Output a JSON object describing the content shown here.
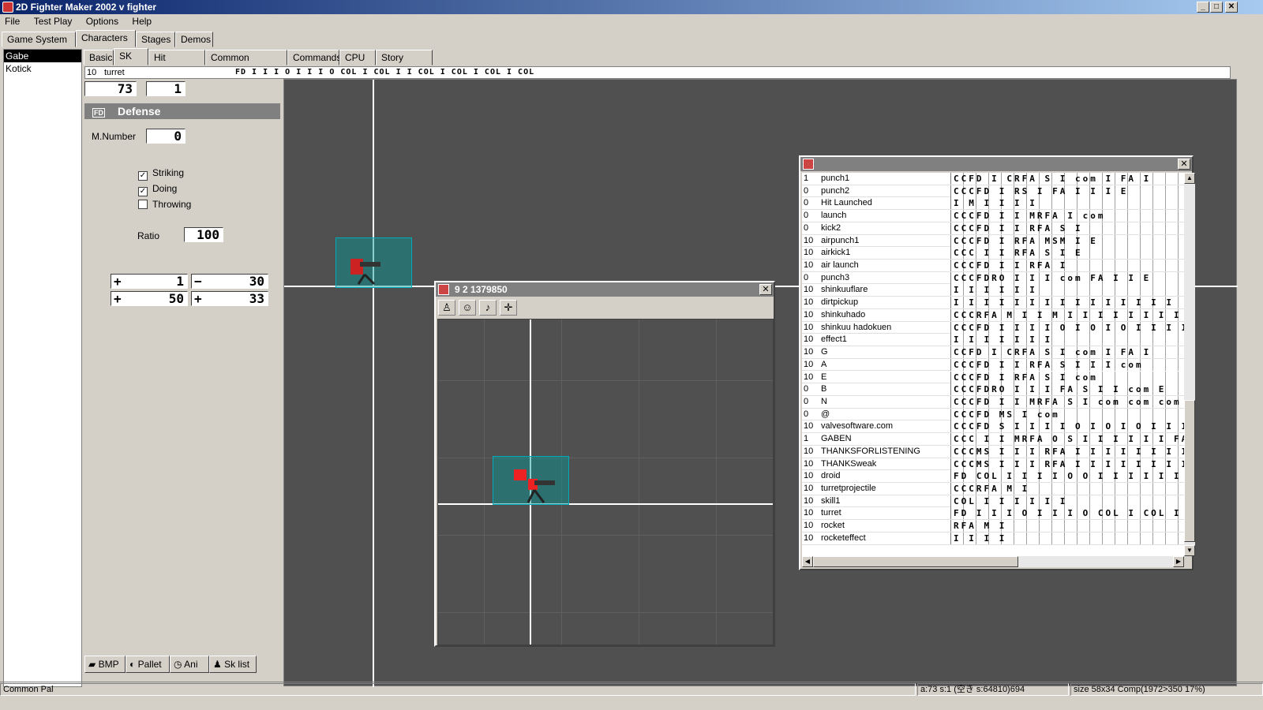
{
  "window": {
    "title": "2D Fighter Maker 2002  v fighter"
  },
  "menu": [
    "File",
    "Test Play",
    "Options",
    "Help"
  ],
  "main_tabs": [
    "Game System",
    "Characters",
    "Stages",
    "Demos"
  ],
  "characters": [
    "Gabe",
    "Kotick"
  ],
  "sub_tabs": [
    "Basic",
    "SK",
    "Hit Junction",
    "Common Images",
    "Commands",
    "CPU",
    "Story mode"
  ],
  "sk_field": {
    "num": "10",
    "name": "turret",
    "cmds": "FD I I I O I I I O COL I COL I I COL I COL I COL I COL"
  },
  "fields": {
    "frame": "73",
    "sub": "1"
  },
  "defense": {
    "fd": "FD",
    "title": "Defense",
    "mnumber_label": "M.Number",
    "mnumber": "0",
    "striking": "Striking",
    "doing": "Doing",
    "throwing": "Throwing",
    "ratio_label": "Ratio",
    "ratio": "100"
  },
  "offsets": {
    "a": "1",
    "b": "30",
    "c": "50",
    "d": "33"
  },
  "signs": {
    "plus": "+",
    "minus": "−"
  },
  "bottom_buttons": [
    "BMP",
    "Pallet",
    "Ani",
    "Sk list"
  ],
  "subwin": {
    "title": "9 2  1379850",
    "close": "✕"
  },
  "sklist_close": "✕",
  "sklist": [
    {
      "n": "1",
      "name": "punch1",
      "c": "CCFD I CRFA S I com I FA I"
    },
    {
      "n": "0",
      "name": "punch2",
      "c": "CCCFD I RS I FA I I I E"
    },
    {
      "n": "0",
      "name": "Hit     Launched",
      "c": "I M I I I I"
    },
    {
      "n": "0",
      "name": "launch",
      "c": "CCCFD I I MRFA I com"
    },
    {
      "n": "0",
      "name": "kick2",
      "c": "CCCFD I I RFA S I"
    },
    {
      "n": "10",
      "name": "airpunch1",
      "c": "CCCFD I RFA MSM I E"
    },
    {
      "n": "10",
      "name": "airkick1",
      "c": "CCC I I RFA S I E"
    },
    {
      "n": "10",
      "name": "air launch",
      "c": "CCCFD I I RFA I"
    },
    {
      "n": "0",
      "name": "punch3",
      "c": "CCCFDRO I I I com FA I I E"
    },
    {
      "n": "10",
      "name": "shinkuuflare",
      "c": "I I I I I I"
    },
    {
      "n": "10",
      "name": "dirtpickup",
      "c": "I I I I I I I I I I I I I I I"
    },
    {
      "n": "10",
      "name": "shinkuhado",
      "c": "CCCRFA M I I M I I I I I I I I I"
    },
    {
      "n": "10",
      "name": "shinkuu hadokuen",
      "c": "CCCFD I I I I O I O I O I I I I I"
    },
    {
      "n": "10",
      "name": "effect1",
      "c": "I I I I I I I"
    },
    {
      "n": "10",
      "name": "G",
      "c": "CCFD I CRFA S I com I FA I"
    },
    {
      "n": "10",
      "name": "A",
      "c": "CCCFD I I RFA S I I I com"
    },
    {
      "n": "10",
      "name": "E",
      "c": "CCCFD I RFA S I com"
    },
    {
      "n": "0",
      "name": "B",
      "c": "CCCFDRO I I I FA S I I com E"
    },
    {
      "n": "0",
      "name": "N",
      "c": "CCCFD I I MRFA S I com com com"
    },
    {
      "n": "0",
      "name": "@",
      "c": "CCCFD MS I com"
    },
    {
      "n": "10",
      "name": "valvesoftware.com",
      "c": "CCCFD S I I I I O I O I O I I I I"
    },
    {
      "n": "1",
      "name": "GABEN",
      "c": "CCC I I MRFA O S I I I I I I FA I M"
    },
    {
      "n": "10",
      "name": "THANKSFORLISTENING",
      "c": "CCCMS I I I RFA I I I I I I I I I I"
    },
    {
      "n": "10",
      "name": "THANKSweak",
      "c": "CCCMS I I I RFA I I I I I I I I I I"
    },
    {
      "n": "10",
      "name": "droid",
      "c": "FD COL I I I I O O I I I I I I O I O I O"
    },
    {
      "n": "10",
      "name": "turretprojectile",
      "c": "CCCRFA M I"
    },
    {
      "n": "10",
      "name": "skill1",
      "c": "COL I I I I I I"
    },
    {
      "n": "10",
      "name": "turret",
      "c": "FD I I I O I I I O COL I COL I I COL I COL I"
    },
    {
      "n": "10",
      "name": "rocket",
      "c": "RFA M I"
    },
    {
      "n": "10",
      "name": "rocketeffect",
      "c": "I I I I"
    }
  ],
  "status": {
    "left": "Common Pal",
    "mid": "a:73 s:1 (空き s:64810)694",
    "right": "size 58x34 Comp(1972>350 17%)"
  },
  "colors": {
    "title_start": "#0a246a",
    "title_end": "#a6caf0",
    "canvas": "#505050",
    "hitbox": "#0aa0a0"
  }
}
